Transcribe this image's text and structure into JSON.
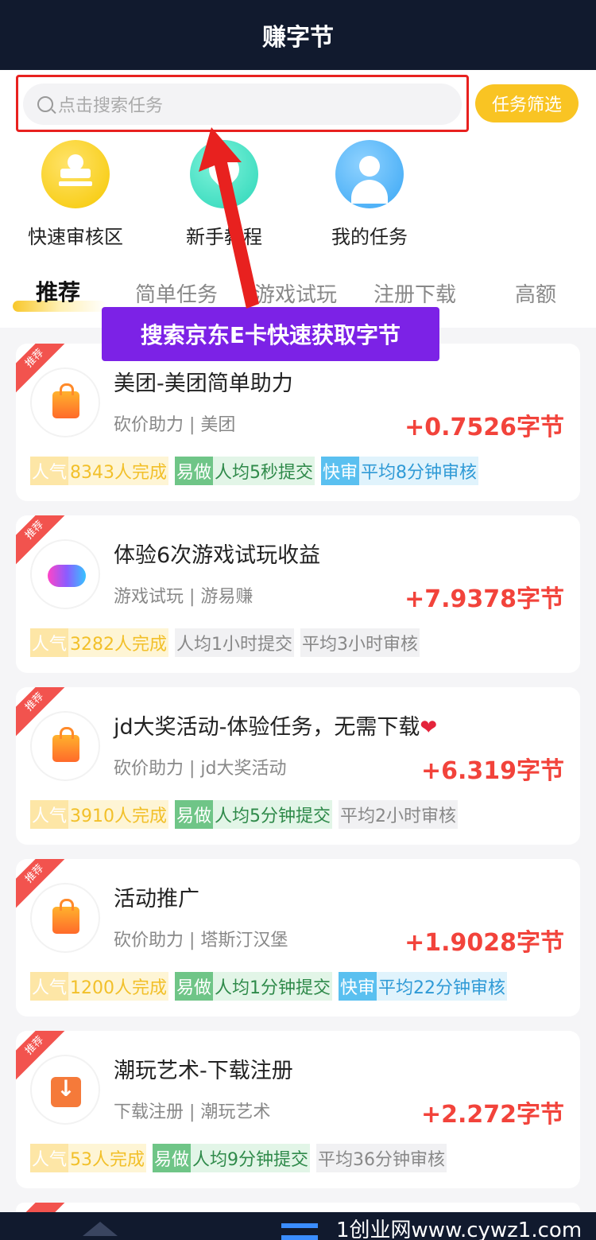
{
  "app": {
    "title": "赚字节"
  },
  "search": {
    "placeholder": "点击搜索任务"
  },
  "filter_button": "任务筛选",
  "quick_links": [
    {
      "label": "快速审核区",
      "icon": "stamp-icon"
    },
    {
      "label": "新手教程",
      "icon": "location-pin-icon"
    },
    {
      "label": "我的任务",
      "icon": "user-icon"
    }
  ],
  "tabs": [
    "推荐",
    "简单任务",
    "游戏试玩",
    "注册下载",
    "高额"
  ],
  "overlay": {
    "banner": "搜索京东E卡快速获取字节"
  },
  "cards": [
    {
      "ribbon": "推荐",
      "title": "美团-美团简单助力",
      "subtitle": "砍价助力 | 美团",
      "reward": "+0.7526字节",
      "tags": [
        {
          "k": "人气",
          "v": "8343人完成"
        },
        {
          "k": "易做",
          "v": "人均5秒提交"
        },
        {
          "k": "快审",
          "v": "平均8分钟审核"
        }
      ]
    },
    {
      "ribbon": "推荐",
      "title": "体验6次游戏试玩收益",
      "subtitle": "游戏试玩 | 游易赚",
      "reward": "+7.9378字节",
      "tags": [
        {
          "k": "人气",
          "v": "3282人完成"
        },
        {
          "v": "人均1小时提交"
        },
        {
          "v": "平均3小时审核"
        }
      ]
    },
    {
      "ribbon": "推荐",
      "title": "jd大奖活动-体验任务，无需下载",
      "subtitle": "砍价助力 | jd大奖活动",
      "reward": "+6.319字节",
      "tags": [
        {
          "k": "人气",
          "v": "3910人完成"
        },
        {
          "k": "易做",
          "v": "人均5分钟提交"
        },
        {
          "v": "平均2小时审核"
        }
      ]
    },
    {
      "ribbon": "推荐",
      "title": "活动推广",
      "subtitle": "砍价助力 | 塔斯汀汉堡",
      "reward": "+1.9028字节",
      "tags": [
        {
          "k": "人气",
          "v": "1200人完成"
        },
        {
          "k": "易做",
          "v": "人均1分钟提交"
        },
        {
          "k": "快审",
          "v": "平均22分钟审核"
        }
      ]
    },
    {
      "ribbon": "推荐",
      "title": "潮玩艺术-下载注册",
      "subtitle": "下载注册 | 潮玩艺术",
      "reward": "+2.272字节",
      "tags": [
        {
          "k": "人气",
          "v": "53人完成"
        },
        {
          "k": "易做",
          "v": "人均9分钟提交"
        },
        {
          "v": "平均36分钟审核"
        }
      ]
    }
  ],
  "watermark": "1创业网www.cywz1.com",
  "colors": {
    "header": "#111a2e",
    "accent": "#f9c423",
    "reward": "#f2433b",
    "banner": "#7c22e6"
  }
}
